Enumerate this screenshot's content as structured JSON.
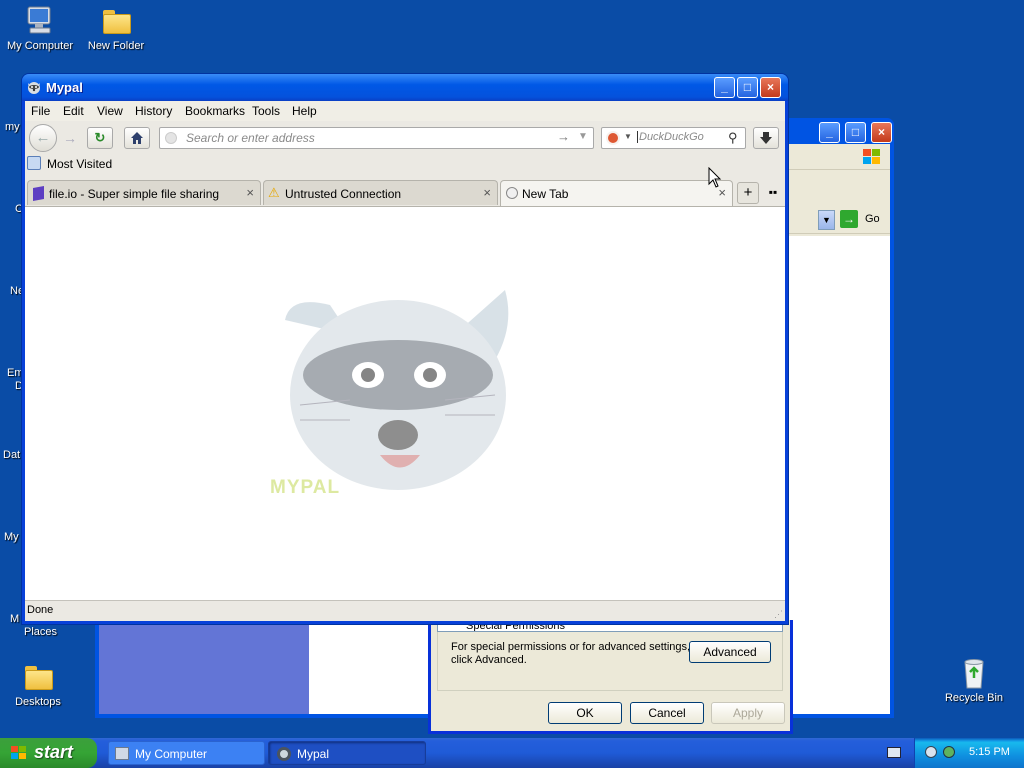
{
  "desktop": {
    "icons": [
      {
        "label": "My Computer"
      },
      {
        "label": "New Folder"
      },
      {
        "label": "Desktops"
      },
      {
        "label": "Recycle Bin"
      }
    ],
    "partial_labels": [
      "my",
      "C",
      "Ne",
      "Em",
      "D",
      "Dat",
      "My",
      "M",
      "Places"
    ]
  },
  "back_window": {
    "go_label": "Go"
  },
  "browser": {
    "title": "Mypal",
    "menu": [
      "File",
      "Edit",
      "View",
      "History",
      "Bookmarks",
      "Tools",
      "Help"
    ],
    "address_placeholder": "Search or enter address",
    "search_placeholder": "DuckDuckGo",
    "bookmarks": [
      {
        "label": "Most Visited"
      }
    ],
    "tabs": [
      {
        "label": "file.io - Super simple file sharing",
        "active": false
      },
      {
        "label": "Untrusted Connection",
        "active": false
      },
      {
        "label": "New Tab",
        "active": true
      }
    ],
    "logo_text": "MYPAL",
    "status": "Done"
  },
  "dialog": {
    "special_permissions_label": "Special Permissions",
    "advanced_text_line1": "For special permissions or for advanced settings,",
    "advanced_text_line2": "click Advanced.",
    "advanced_button": "Advanced",
    "ok_button": "OK",
    "cancel_button": "Cancel",
    "apply_button": "Apply"
  },
  "taskbar": {
    "start_label": "start",
    "items": [
      {
        "label": "My Computer",
        "active": false
      },
      {
        "label": "Mypal",
        "active": true
      }
    ],
    "clock": "5:15 PM"
  },
  "colors": {
    "desktop": "#0a4ca6",
    "titlebar": "#0058e6",
    "taskbar": "#245edb",
    "start_green": "#35a435"
  }
}
